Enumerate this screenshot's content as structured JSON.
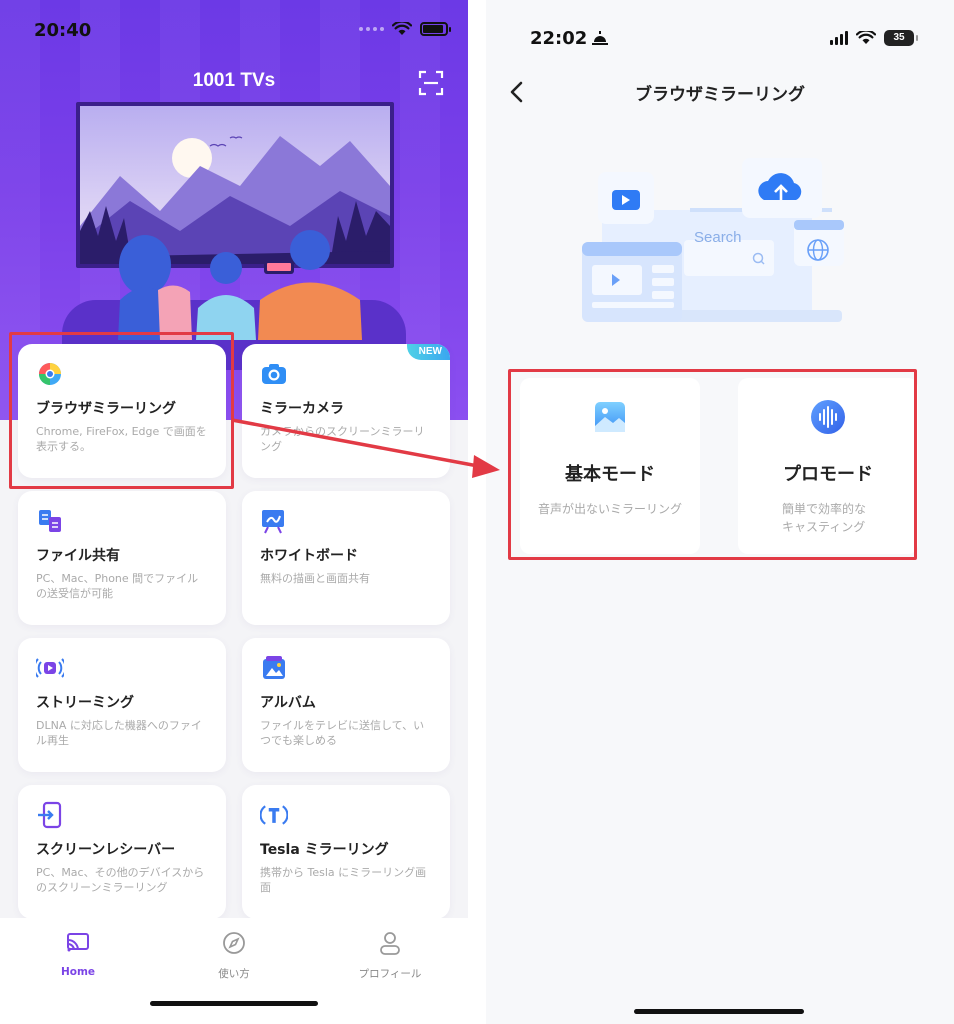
{
  "left": {
    "status": {
      "time": "20:40"
    },
    "app_title": "1001 TVs",
    "cards": [
      {
        "title": "ブラウザミラーリング",
        "desc": "Chrome, FireFox, Edge で画面を表示する。",
        "icon": "browser-globe-icon",
        "badge": ""
      },
      {
        "title": "ミラーカメラ",
        "desc": "カメラからのスクリーンミラーリング",
        "icon": "camera-icon",
        "badge": "NEW"
      },
      {
        "title": "ファイル共有",
        "desc": "PC、Mac、Phone 間でファイルの送受信が可能",
        "icon": "file-share-icon",
        "badge": ""
      },
      {
        "title": "ホワイトボード",
        "desc": "無料の描画と画面共有",
        "icon": "whiteboard-icon",
        "badge": ""
      },
      {
        "title": "ストリーミング",
        "desc": "DLNA に対応した機器へのファイル再生",
        "icon": "streaming-icon",
        "badge": ""
      },
      {
        "title": "アルバム",
        "desc": "ファイルをテレビに送信して、いつでも楽しめる",
        "icon": "album-icon",
        "badge": ""
      },
      {
        "title": "スクリーンレシーバー",
        "desc": "PC、Mac、その他のデバイスからのスクリーンミラーリング",
        "icon": "screen-receiver-icon",
        "badge": ""
      },
      {
        "title": "Tesla ミラーリング",
        "desc": "携帯から Tesla にミラーリング画面",
        "icon": "tesla-icon",
        "badge": ""
      }
    ],
    "tabs": [
      {
        "label": "Home",
        "icon": "cast-icon",
        "active": true
      },
      {
        "label": "使い方",
        "icon": "compass-icon",
        "active": false
      },
      {
        "label": "プロフィール",
        "icon": "profile-icon",
        "active": false
      }
    ]
  },
  "right": {
    "status": {
      "time": "22:02",
      "battery": "35"
    },
    "title": "ブラウザミラーリング",
    "illustration": {
      "search_label": "Search"
    },
    "modes": [
      {
        "title": "基本モード",
        "desc": "音声が出ないミラーリング",
        "icon": "image-mode-icon"
      },
      {
        "title": "プロモード",
        "desc": "簡単で効率的なキャスティング",
        "icon": "sound-wave-icon"
      }
    ]
  },
  "colors": {
    "accent": "#7b44e6",
    "highlight": "#e23a45",
    "hero": "#6c39e6"
  }
}
